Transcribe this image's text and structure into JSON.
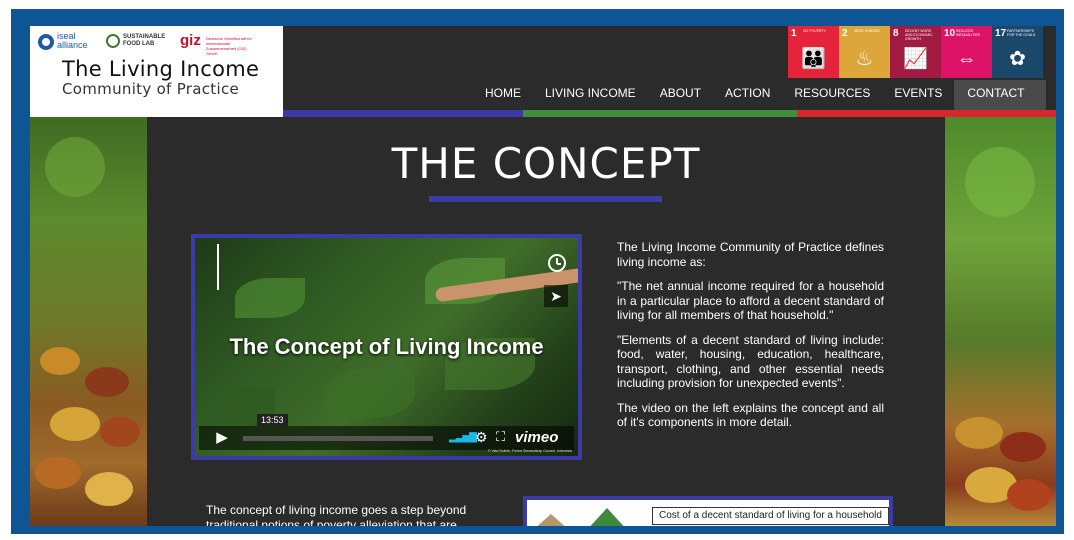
{
  "header": {
    "partners": {
      "iseal": "iseal alliance",
      "sfl": "SUSTAINABLE FOOD LAB",
      "giz": "giz",
      "giz_sub": "Deutsche Gesellschaft für Internationale Zusammenarbeit (GIZ) GmbH"
    },
    "title_line1": "The Living Income",
    "title_line2": "Community of Practice"
  },
  "sdgs": [
    {
      "num": "1",
      "label": "No Poverty",
      "color": "#e5243b",
      "icon": "people-icon"
    },
    {
      "num": "2",
      "label": "Zero Hunger",
      "color": "#dda63a",
      "icon": "bowl-icon"
    },
    {
      "num": "8",
      "label": "Decent Work and Economic Growth",
      "color": "#a21942",
      "icon": "growth-chart-icon"
    },
    {
      "num": "10",
      "label": "Reduced Inequalities",
      "color": "#dd1367",
      "icon": "equality-icon"
    },
    {
      "num": "17",
      "label": "Partnerships for the Goals",
      "color": "#19486a",
      "icon": "flower-icon"
    }
  ],
  "nav": {
    "items": [
      "HOME",
      "LIVING INCOME",
      "ABOUT",
      "ACTION",
      "RESOURCES",
      "EVENTS",
      "CONTACT"
    ],
    "active": "CONTACT",
    "bar_colors": [
      "#3c3aa6",
      "#3e8e3a",
      "#d8262d"
    ]
  },
  "main": {
    "heading": "THE CONCEPT",
    "video": {
      "title": "The Concept of Living Income",
      "duration": "13:53",
      "brand": "vimeo",
      "credit": "© Vlad Sokhin, Forest Stewardship Council, Indonesia",
      "progress": 0.0
    },
    "paragraphs": [
      "The Living Income Community of Practice defines living income as:",
      "\"The net annual income required for a household in a particular place to afford a decent standard of living for all members of that household.\"",
      "\"Elements of a decent standard of living include: food, water, housing, education, healthcare, transport, clothing, and other essential needs including provision for unexpected events\".",
      "The video on the left explains the concept and all of it's components in more detail."
    ],
    "bottom_text": "The concept of living income goes a step beyond traditional notions of poverty alleviation that are",
    "cost_label": "Cost of a decent standard of living for a household"
  },
  "colors": {
    "frame": "#0e5596",
    "page_bg": "#2b2b2b",
    "accent": "#3c3aa6"
  }
}
